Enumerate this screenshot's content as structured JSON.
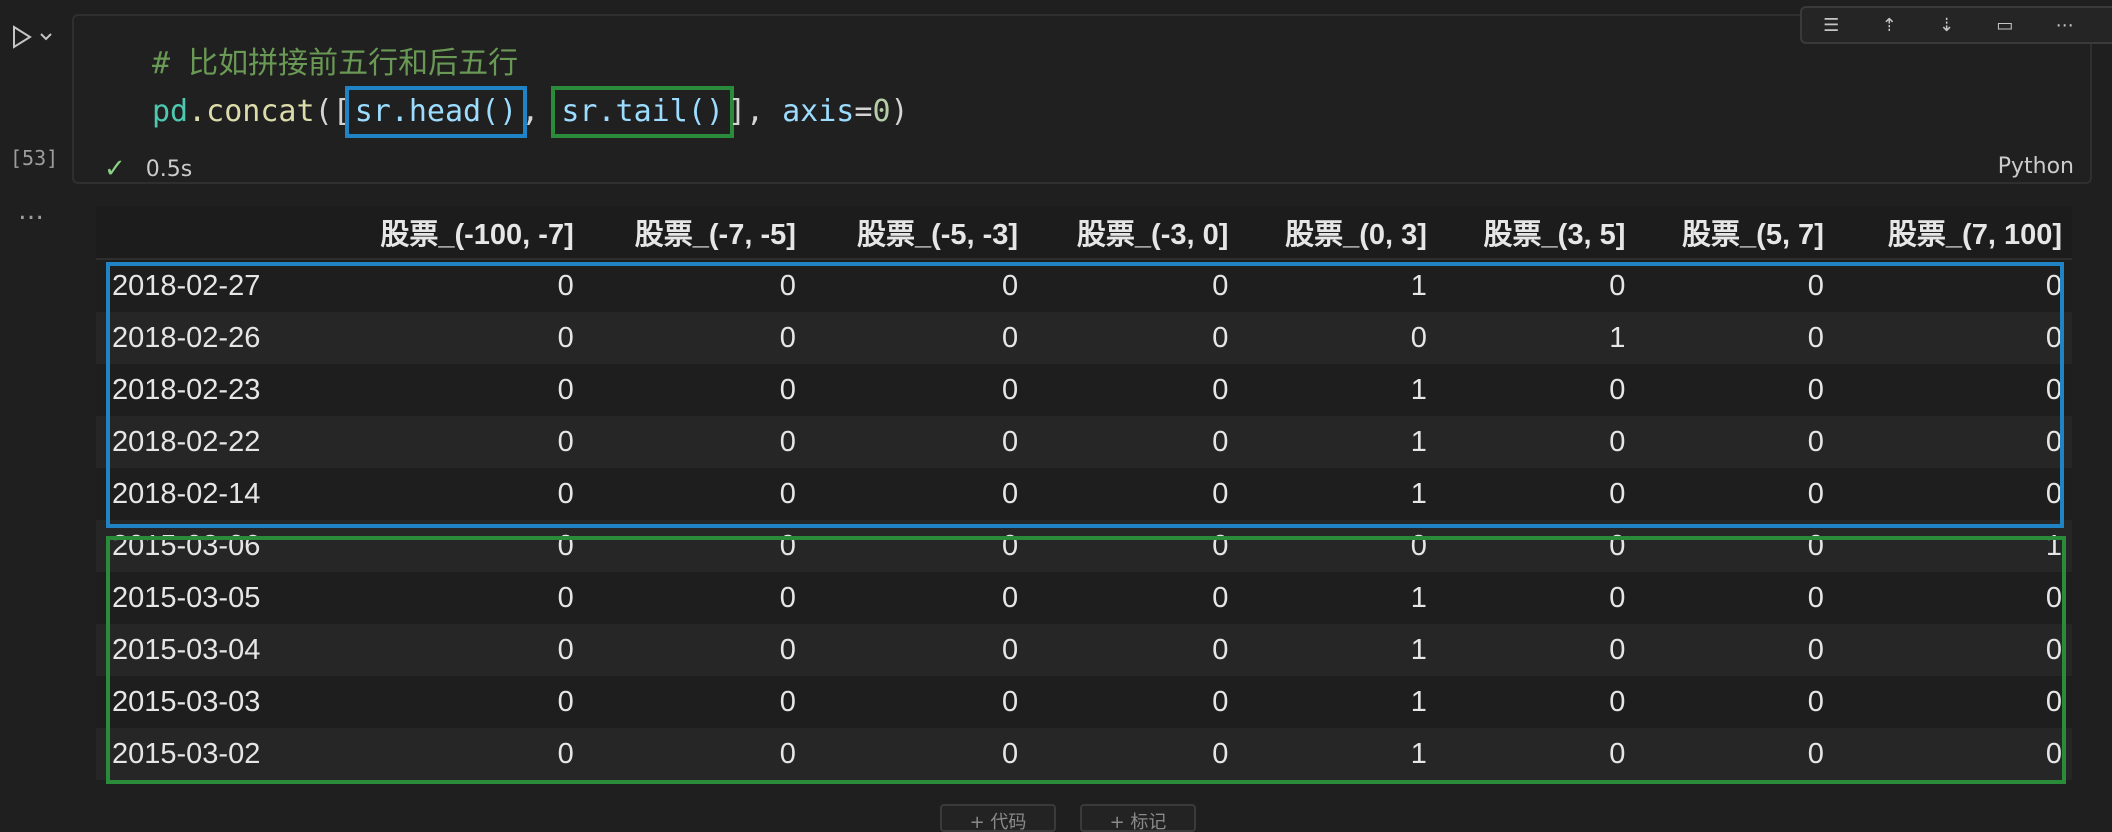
{
  "cell": {
    "exec_count": "[53]",
    "status_time": "0.5s",
    "language": "Python",
    "code": {
      "comment": "# 比如拼接前五行和后五行",
      "pd": "pd",
      "concat_fn": ".concat",
      "open": "([",
      "head": "sr.head()",
      "sep": ", ",
      "tail": "sr.tail()",
      "close_bracket": "], ",
      "axis_kw": "axis",
      "eq": "=",
      "axis_val": "0",
      "close_paren": ")"
    },
    "toolbar_icons": [
      "run-by-line-icon",
      "execute-above-icon",
      "execute-below-icon",
      "split-cell-icon",
      "more-icon",
      "delete-icon"
    ]
  },
  "output": {
    "more": "…",
    "columns": [
      "",
      "股票_(-100, -7]",
      "股票_(-7, -5]",
      "股票_(-5, -3]",
      "股票_(-3, 0]",
      "股票_(0, 3]",
      "股票_(3, 5]",
      "股票_(5, 7]",
      "股票_(7, 100]"
    ],
    "rows": [
      [
        "2018-02-27",
        "0",
        "0",
        "0",
        "0",
        "1",
        "0",
        "0",
        "0"
      ],
      [
        "2018-02-26",
        "0",
        "0",
        "0",
        "0",
        "0",
        "1",
        "0",
        "0"
      ],
      [
        "2018-02-23",
        "0",
        "0",
        "0",
        "0",
        "1",
        "0",
        "0",
        "0"
      ],
      [
        "2018-02-22",
        "0",
        "0",
        "0",
        "0",
        "1",
        "0",
        "0",
        "0"
      ],
      [
        "2018-02-14",
        "0",
        "0",
        "0",
        "0",
        "1",
        "0",
        "0",
        "0"
      ],
      [
        "2015-03-06",
        "0",
        "0",
        "0",
        "0",
        "0",
        "0",
        "0",
        "1"
      ],
      [
        "2015-03-05",
        "0",
        "0",
        "0",
        "0",
        "1",
        "0",
        "0",
        "0"
      ],
      [
        "2015-03-04",
        "0",
        "0",
        "0",
        "0",
        "1",
        "0",
        "0",
        "0"
      ],
      [
        "2015-03-03",
        "0",
        "0",
        "0",
        "0",
        "1",
        "0",
        "0",
        "0"
      ],
      [
        "2015-03-02",
        "0",
        "0",
        "0",
        "0",
        "1",
        "0",
        "0",
        "0"
      ]
    ]
  },
  "colors": {
    "highlight_head": "#1f83c4",
    "highlight_tail": "#2a8c3a"
  },
  "bottom_buttons": [
    "+ 代码",
    "+ 标记"
  ]
}
